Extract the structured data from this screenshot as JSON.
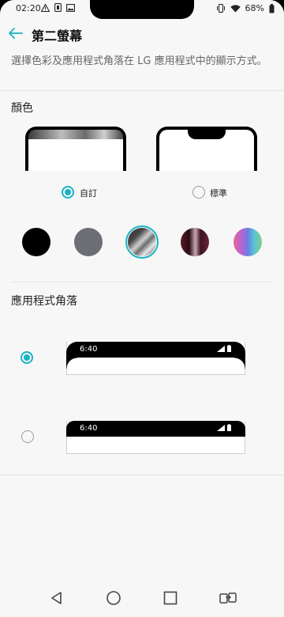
{
  "status": {
    "time": "02:20",
    "battery": "68%"
  },
  "header": {
    "title": "第二螢幕"
  },
  "description": "選擇色彩及應用程式角落在 LG 應用程式中的顯示方式。",
  "color_section": {
    "title": "顏色",
    "options": [
      {
        "label": "自訂",
        "selected": true
      },
      {
        "label": "標準",
        "selected": false
      }
    ],
    "swatches": [
      {
        "name": "black",
        "color": "#000000"
      },
      {
        "name": "gray",
        "color": "#6b6e74"
      },
      {
        "name": "silver-gradient",
        "color": "#555555",
        "selected": true
      },
      {
        "name": "burgundy-gradient",
        "color": "#5a2030"
      },
      {
        "name": "rainbow-gradient",
        "color": "#7a6fd0"
      }
    ],
    "accent": "#19b3c4"
  },
  "corner_section": {
    "title": "應用程式角落",
    "options": [
      {
        "style": "rounded",
        "selected": true,
        "preview_time": "6:40"
      },
      {
        "style": "square",
        "selected": false,
        "preview_time": "6:40"
      }
    ]
  }
}
